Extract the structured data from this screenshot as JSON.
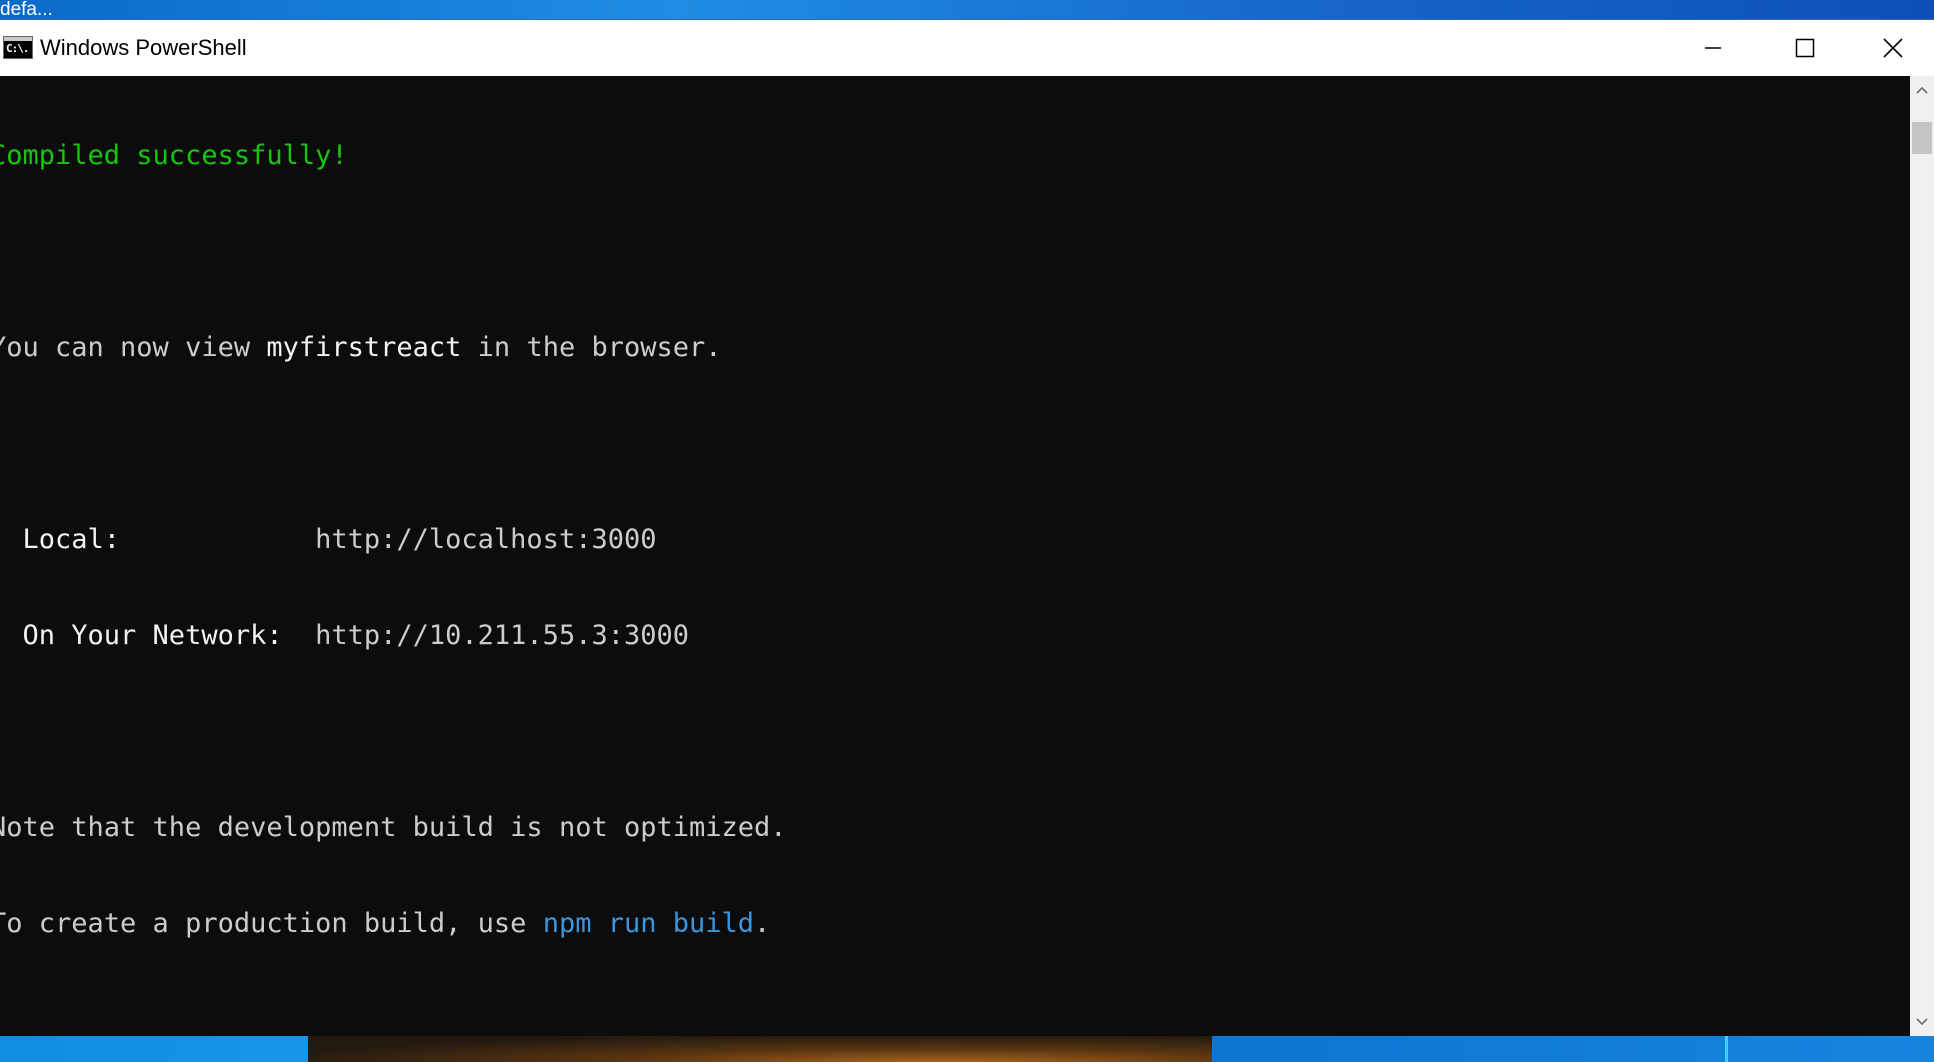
{
  "desktop": {
    "behind_window_title": "defa..."
  },
  "window": {
    "title": "Windows PowerShell",
    "icon": "console-icon",
    "icon_glyph": "C:\\."
  },
  "caption_buttons": {
    "minimize": "minimize-icon",
    "maximize": "maximize-icon",
    "close": "close-icon"
  },
  "console": {
    "compiled": "Compiled successfully!",
    "view_prefix": "You can now view ",
    "app_name": "myfirstreact",
    "view_suffix": " in the browser.",
    "local_label": "  Local:            ",
    "local_url": "http://localhost:3000",
    "network_label": "  On Your Network:  ",
    "network_url": "http://10.211.55.3:3000",
    "note_line": "Note that the development build is not optimized.",
    "prod_prefix": "To create a production build, use ",
    "prod_command": "npm run build",
    "prod_suffix": "."
  },
  "colors": {
    "console_background": "#0c0c0c",
    "console_text": "#cccccc",
    "success_green": "#16c60c",
    "command_blue": "#3a96dd"
  },
  "scrollbar": {
    "up": "scroll-up-arrow-icon",
    "down": "scroll-down-arrow-icon"
  }
}
